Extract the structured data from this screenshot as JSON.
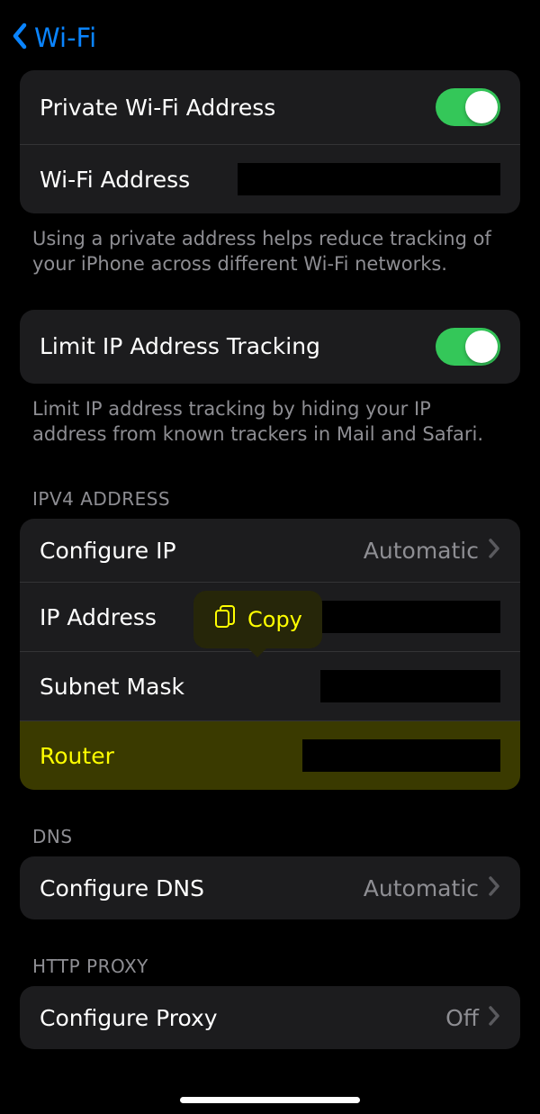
{
  "nav": {
    "back_label": "Wi-Fi"
  },
  "privacy_group": {
    "private_addr_label": "Private Wi-Fi Address",
    "private_addr_on": true,
    "wifi_addr_label": "Wi-Fi Address",
    "footer": "Using a private address helps reduce tracking of your iPhone across different Wi-Fi networks."
  },
  "tracking_group": {
    "label": "Limit IP Address Tracking",
    "on": true,
    "footer": "Limit IP address tracking by hiding your IP address from known trackers in Mail and Safari."
  },
  "ipv4": {
    "header": "IPV4 ADDRESS",
    "configure_label": "Configure IP",
    "configure_value": "Automatic",
    "ip_label": "IP Address",
    "subnet_label": "Subnet Mask",
    "router_label": "Router"
  },
  "dns": {
    "header": "DNS",
    "configure_label": "Configure DNS",
    "configure_value": "Automatic"
  },
  "proxy": {
    "header": "HTTP PROXY",
    "configure_label": "Configure Proxy",
    "configure_value": "Off"
  },
  "popover": {
    "copy_label": "Copy"
  }
}
